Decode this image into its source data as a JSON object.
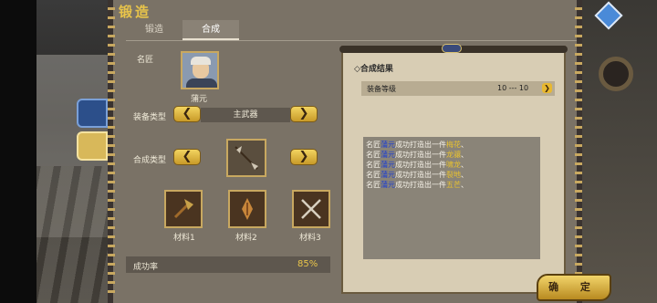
{
  "window": {
    "title": "锻造"
  },
  "tabs": [
    {
      "label": "锻造",
      "active": false
    },
    {
      "label": "合成",
      "active": true
    }
  ],
  "smith": {
    "label": "名匠",
    "name": "蒲元"
  },
  "equipment_type": {
    "label": "装备类型",
    "value": "主武器"
  },
  "synthesis_type": {
    "label": "合成类型"
  },
  "materials": [
    {
      "label": "材料1",
      "icon": "axe-icon"
    },
    {
      "label": "材料2",
      "icon": "spearhead-icon"
    },
    {
      "label": "材料3",
      "icon": "crossed-swords-icon"
    }
  ],
  "success_rate": {
    "label": "成功率",
    "value": "85%"
  },
  "result": {
    "header": "合成结果",
    "grade_label": "装备等级",
    "grade_value": "10 --- 10",
    "log": [
      {
        "prefix": "名匠",
        "name": "蒲元",
        "mid": "成功打造出一件",
        "weapon": "梅花",
        "suffix": "、"
      },
      {
        "prefix": "名匠",
        "name": "蒲元",
        "mid": "成功打造出一件",
        "weapon": "龙骧",
        "suffix": "、"
      },
      {
        "prefix": "名匠",
        "name": "蒲元",
        "mid": "成功打造出一件",
        "weapon": "啸龙",
        "suffix": "、"
      },
      {
        "prefix": "名匠",
        "name": "蒲元",
        "mid": "成功打造出一件",
        "weapon": "裂地",
        "suffix": "、"
      },
      {
        "prefix": "名匠",
        "name": "蒲元",
        "mid": "成功打造出一件",
        "weapon": "五芒",
        "suffix": "、"
      }
    ]
  },
  "buttons": {
    "confirm": "确 定",
    "prev": "❮",
    "next": "❯"
  },
  "colors": {
    "accent": "#e8c44a",
    "name_text": "#1e3fd0",
    "weapon_text": "#e8c230"
  }
}
